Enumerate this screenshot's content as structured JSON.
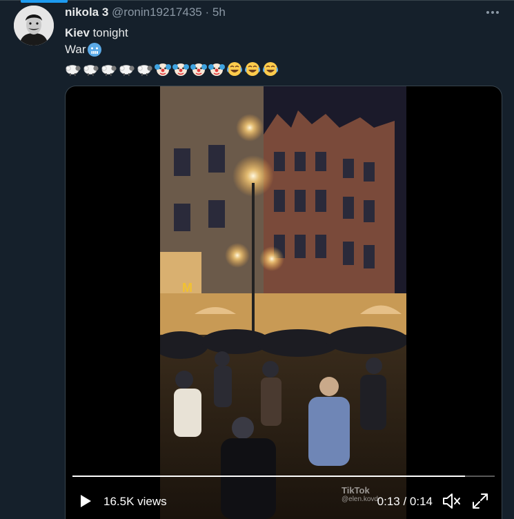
{
  "author": {
    "name": "nikola 3",
    "handle": "@ronin19217435",
    "separator": "·",
    "time": "5h"
  },
  "tweet": {
    "line1_bold": "Kiev",
    "line1_rest": " tonight",
    "line2": "War",
    "emojis": [
      "sheep",
      "sheep",
      "sheep",
      "sheep",
      "sheep",
      "clown",
      "clown",
      "clown",
      "clown",
      "joy",
      "joy",
      "joy"
    ]
  },
  "media": {
    "views": "16.5K views",
    "current_time": "0:13",
    "time_sep": " / ",
    "duration": "0:14",
    "progress": 0.93,
    "watermark": "TikTok",
    "watermark_user": "@elen.kovd"
  },
  "colors": {
    "background": "#15202b",
    "accent": "#1d9bf0",
    "muted": "#8b98a5"
  }
}
